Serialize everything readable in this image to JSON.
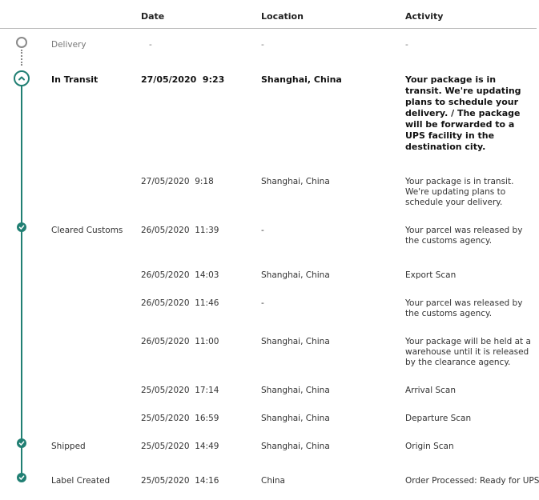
{
  "header": {
    "date": "Date",
    "location": "Location",
    "activity": "Activity"
  },
  "rows": [
    {
      "status": "Delivery",
      "date": "-",
      "location": "-",
      "activity": "-"
    },
    {
      "status": "In Transit",
      "date": "27/05/2020  9:23",
      "location": "Shanghai, China",
      "activity": "Your package is in transit. We're updating plans to schedule your delivery. / The package will be forwarded to a UPS facility in the destination city."
    },
    {
      "status": "",
      "date": "27/05/2020  9:18",
      "location": "Shanghai, China",
      "activity": "Your package is in transit. We're updating plans to schedule your delivery."
    },
    {
      "status": "Cleared Customs",
      "date": "26/05/2020  11:39",
      "location": "-",
      "activity": "Your parcel was released by the customs agency."
    },
    {
      "status": "",
      "date": "26/05/2020  14:03",
      "location": "Shanghai, China",
      "activity": "Export Scan"
    },
    {
      "status": "",
      "date": "26/05/2020  11:46",
      "location": "-",
      "activity": "Your parcel was released by the customs agency."
    },
    {
      "status": "",
      "date": "26/05/2020  11:00",
      "location": "Shanghai, China",
      "activity": "Your package will be held at a warehouse until it is released by the clearance agency."
    },
    {
      "status": "",
      "date": "25/05/2020  17:14",
      "location": "Shanghai, China",
      "activity": "Arrival Scan"
    },
    {
      "status": "",
      "date": "25/05/2020  16:59",
      "location": "Shanghai, China",
      "activity": "Departure Scan"
    },
    {
      "status": "Shipped",
      "date": "25/05/2020  14:49",
      "location": "Shanghai, China",
      "activity": "Origin Scan"
    },
    {
      "status": "Label Created",
      "date": "25/05/2020  14:16",
      "location": "China",
      "activity": "Order Processed: Ready for UPS"
    }
  ],
  "colors": {
    "accent": "#207f73",
    "pending": "#8a8a8a"
  },
  "icons": {
    "pending": "circle-outline-icon",
    "current": "chevron-up-icon",
    "done": "check-icon"
  }
}
